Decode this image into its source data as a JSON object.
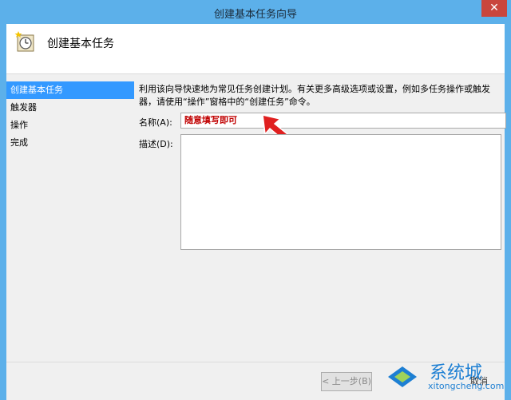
{
  "window": {
    "title": "创建基本任务向导",
    "close_symbol": "✕"
  },
  "header": {
    "title": "创建基本任务",
    "icon": "task-clock-icon"
  },
  "nav": {
    "items": [
      {
        "label": "创建基本任务",
        "active": true
      },
      {
        "label": "触发器",
        "active": false
      },
      {
        "label": "操作",
        "active": false
      },
      {
        "label": "完成",
        "active": false
      }
    ]
  },
  "content": {
    "description": "利用该向导快速地为常见任务创建计划。有关更多高级选项或设置，例如多任务操作或触发器，请使用“操作”窗格中的“创建任务”命令。",
    "name_label": "名称(A):",
    "name_value": "随意填写即可",
    "desc_label": "描述(D):",
    "desc_value": ""
  },
  "footer": {
    "back_label": "< 上一步(B)",
    "cancel_label": "取消"
  },
  "watermark": {
    "brand": "系统城",
    "url": "xitongcheng.com"
  },
  "colors": {
    "titlebar": "#5cb0ea",
    "nav_active": "#3399ff",
    "close_button": "#c9463d",
    "annotation": "#c00000"
  }
}
